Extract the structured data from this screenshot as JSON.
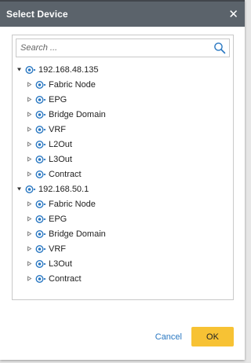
{
  "dialog": {
    "title": "Select Device",
    "close_glyph": "✕"
  },
  "search": {
    "placeholder": "Search ...",
    "value": "",
    "icon": "search-icon"
  },
  "tree": [
    {
      "label": "192.168.48.135",
      "expanded": true,
      "children": [
        "Fabric Node",
        "EPG",
        "Bridge Domain",
        "VRF",
        "L2Out",
        "L3Out",
        "Contract"
      ]
    },
    {
      "label": "192.168.50.1",
      "expanded": true,
      "children": [
        "Fabric Node",
        "EPG",
        "Bridge Domain",
        "VRF",
        "L3Out",
        "Contract"
      ]
    }
  ],
  "footer": {
    "cancel_label": "Cancel",
    "ok_label": "OK"
  },
  "colors": {
    "titlebar": "#5b636b",
    "ok_button": "#f7c234",
    "link": "#2a78c2",
    "node_icon": "#2a78c2"
  }
}
